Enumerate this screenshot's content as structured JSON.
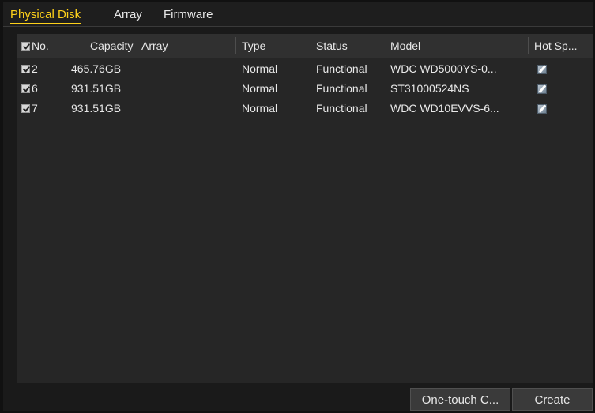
{
  "tabs": [
    {
      "label": "Physical Disk",
      "active": true
    },
    {
      "label": "Array",
      "active": false
    },
    {
      "label": "Firmware",
      "active": false
    }
  ],
  "table": {
    "columns": [
      "No.",
      "Capacity",
      "Array",
      "Type",
      "Status",
      "Model",
      "Hot Sp..."
    ],
    "rows": [
      {
        "no": "2",
        "capacity": "465.76GB",
        "array": "",
        "type": "Normal",
        "status": "Functional",
        "model": "WDC WD5000YS-0..."
      },
      {
        "no": "6",
        "capacity": "931.51GB",
        "array": "",
        "type": "Normal",
        "status": "Functional",
        "model": "ST31000524NS"
      },
      {
        "no": "7",
        "capacity": "931.51GB",
        "array": "",
        "type": "Normal",
        "status": "Functional",
        "model": "WDC WD10EVVS-6..."
      }
    ]
  },
  "buttons": {
    "one_touch": "One-touch C...",
    "create": "Create"
  },
  "icons": {
    "hot_spare": "edit-icon",
    "checkbox": "checkbox-checked-icon"
  },
  "colors": {
    "active_tab": "#ffd21a",
    "background": "#1a1a1a",
    "table_bg": "#262626",
    "header_bg": "#303030"
  }
}
